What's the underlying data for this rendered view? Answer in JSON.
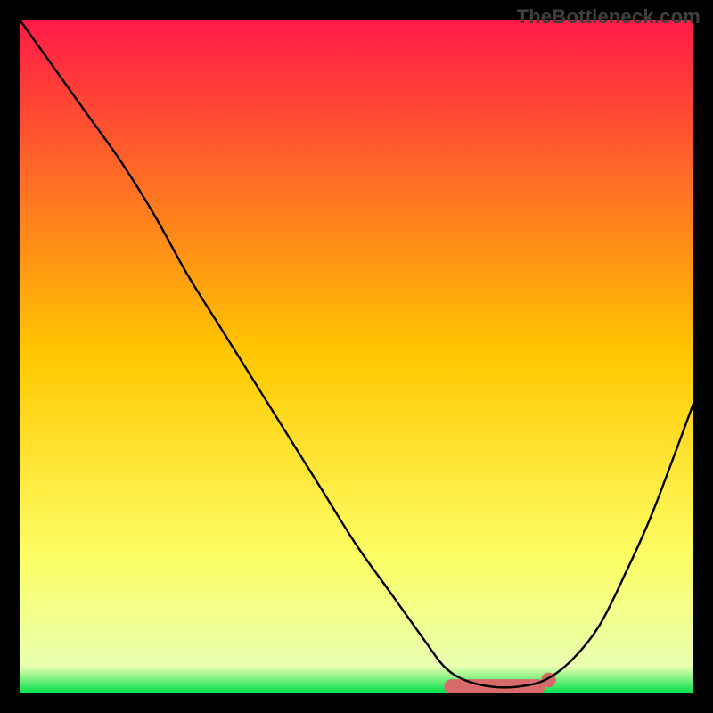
{
  "watermark": "TheBottleneck.com",
  "chart_data": {
    "type": "line",
    "title": "",
    "xlabel": "",
    "ylabel": "",
    "xlim": [
      0,
      100
    ],
    "ylim": [
      0,
      100
    ],
    "grid": false,
    "background_gradient": [
      {
        "offset": 0.0,
        "color": "#ff1a47"
      },
      {
        "offset": 0.5,
        "color": "#ffc800"
      },
      {
        "offset": 0.8,
        "color": "#fcff66"
      },
      {
        "offset": 0.96,
        "color": "#e9ffb0"
      },
      {
        "offset": 1.0,
        "color": "#00e04a"
      }
    ],
    "series": [
      {
        "name": "bottleneck-curve",
        "color": "#000000",
        "x": [
          0,
          5,
          10,
          15,
          20,
          25,
          30,
          35,
          40,
          45,
          50,
          55,
          60,
          63,
          66,
          70,
          74,
          78,
          82,
          86,
          90,
          94,
          100
        ],
        "values": [
          100,
          93,
          86,
          79,
          71,
          62,
          54,
          46,
          38,
          30,
          22,
          15,
          8,
          4,
          2,
          1,
          1,
          2,
          5,
          10,
          18,
          27,
          43
        ]
      }
    ],
    "markers": [
      {
        "name": "optimum-band",
        "shape": "rounded-bar",
        "color": "#d86a6a",
        "x_start": 63,
        "x_end": 78,
        "y": 1,
        "width_pct": 2.2
      },
      {
        "name": "optimum-dot",
        "shape": "circle",
        "color": "#d86a6a",
        "x": 78.5,
        "y": 2,
        "radius_pct": 1.1
      }
    ]
  }
}
